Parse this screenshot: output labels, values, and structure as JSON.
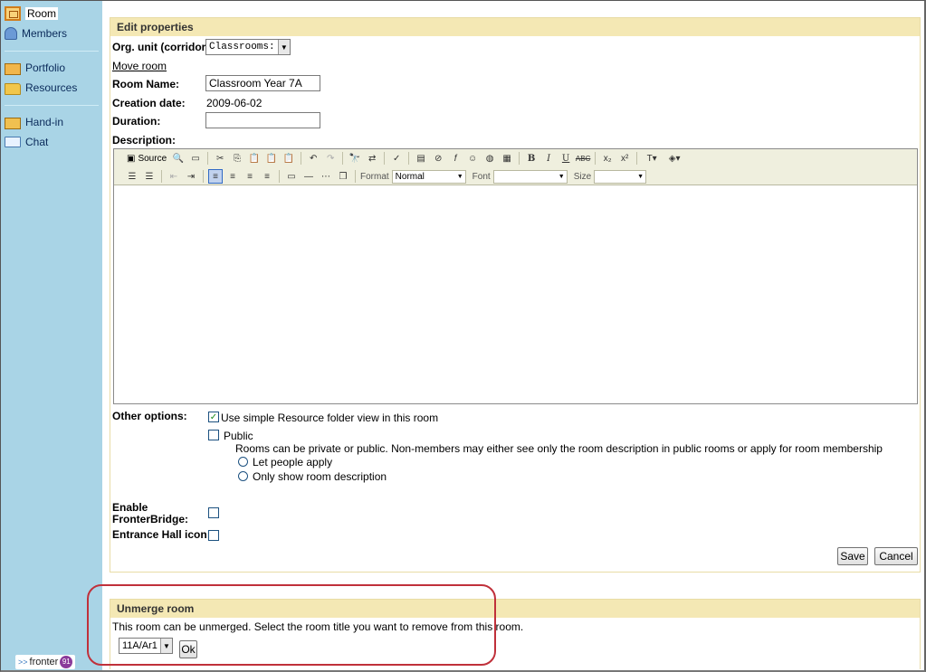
{
  "sidebar": {
    "items": [
      {
        "label": "Room",
        "icon": "room-icon"
      },
      {
        "label": "Members",
        "icon": "members-icon"
      },
      {
        "label": "Portfolio",
        "icon": "portfolio-icon"
      },
      {
        "label": "Resources",
        "icon": "folder-icon"
      },
      {
        "label": "Hand-in",
        "icon": "hand-in-icon"
      },
      {
        "label": "Chat",
        "icon": "chat-icon"
      }
    ],
    "brand": "fronter",
    "brand_badge": "91"
  },
  "edit": {
    "title": "Edit properties",
    "org_unit_label": "Org. unit (corridor):",
    "org_unit_value": "Classrooms:",
    "move_room": "Move room",
    "room_name_label": "Room Name:",
    "room_name_value": "Classroom Year 7A",
    "creation_label": "Creation date:",
    "creation_value": "2009-06-02",
    "duration_label": "Duration:",
    "duration_value": "",
    "description_label": "Description:",
    "toolbar": {
      "source": "Source",
      "format_label": "Format",
      "format_value": "Normal",
      "font_label": "Font",
      "font_value": "",
      "size_label": "Size",
      "size_value": ""
    },
    "other_options_label": "Other options:",
    "simple_view_label": "Use simple Resource folder view in this room",
    "simple_view_checked": true,
    "public_label": "Public",
    "public_checked": false,
    "public_help": "Rooms can be private or public. Non-members may either see only the room description in public rooms or apply for room membership",
    "radio_apply": "Let people apply",
    "radio_show": "Only show room description",
    "fronterbridge_label_1": "Enable",
    "fronterbridge_label_2": "FronterBridge:",
    "entrance_label": "Entrance Hall icon:",
    "save": "Save",
    "cancel": "Cancel"
  },
  "unmerge": {
    "title": "Unmerge room",
    "text": "This room can be unmerged. Select the room title you want to remove from this room.",
    "select_value": "11A/Ar1",
    "ok": "Ok"
  },
  "colors": {
    "sidebar_bg": "#a9d4e6",
    "panel_head_bg": "#f4e8b4",
    "highlight_ring": "#c0303a"
  }
}
